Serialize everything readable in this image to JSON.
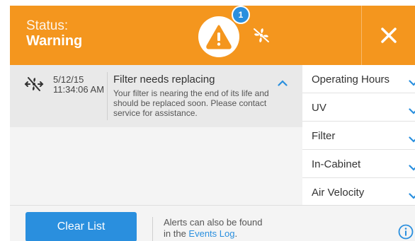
{
  "header": {
    "status_label": "Status:",
    "status_value": "Warning",
    "alert_count": "1",
    "close_icon": "close-icon",
    "warning_icon": "warning-triangle-icon",
    "fan_icon": "fan-off-icon",
    "color": "#f4961e"
  },
  "alert": {
    "date": "5/12/15",
    "time": "11:34:06 AM",
    "title": "Filter needs replacing",
    "body": "Your filter is nearing the end of its life and should be replaced soon. Please contact service for assistance."
  },
  "categories": [
    {
      "label": "Operating Hours"
    },
    {
      "label": "UV"
    },
    {
      "label": "Filter"
    },
    {
      "label": "In-Cabinet"
    },
    {
      "label": "Air Velocity"
    }
  ],
  "footer": {
    "clear_button": "Clear List",
    "note_line1": "Alerts can also be found",
    "note_prefix": "in the ",
    "note_link": "Events Log",
    "note_suffix": ".",
    "info_icon": "info-icon"
  },
  "colors": {
    "accent": "#2a8fde",
    "warning": "#f4961e"
  }
}
